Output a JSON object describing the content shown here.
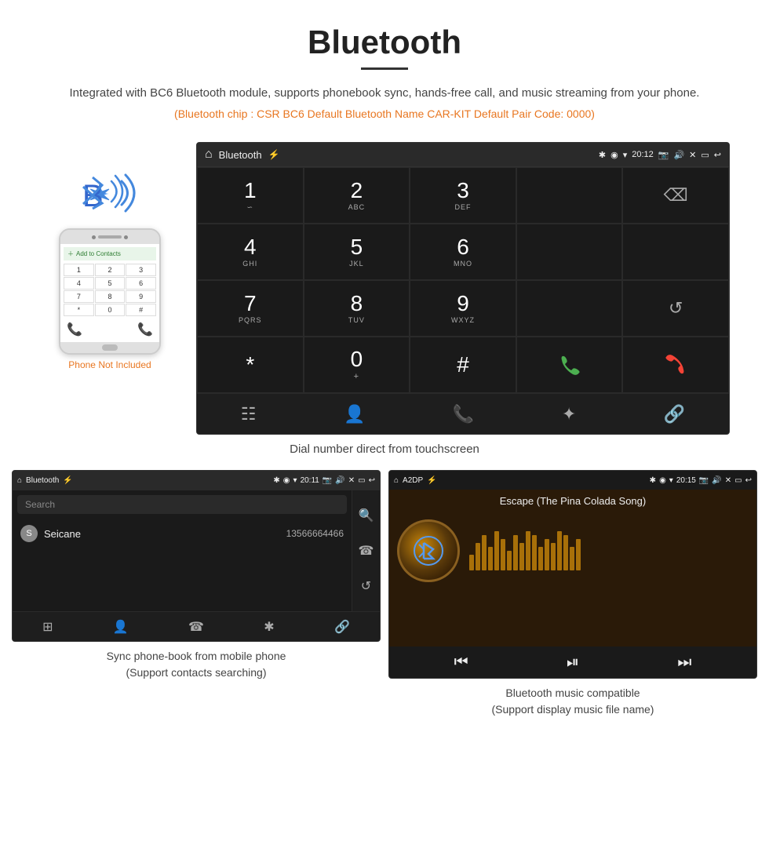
{
  "header": {
    "title": "Bluetooth",
    "description": "Integrated with BC6 Bluetooth module, supports phonebook sync, hands-free call, and music streaming from your phone.",
    "specs": "(Bluetooth chip : CSR BC6    Default Bluetooth Name CAR-KIT    Default Pair Code: 0000)"
  },
  "phone_note": "Phone Not Included",
  "dial_screen": {
    "status_bar": {
      "home": "⌂",
      "label": "Bluetooth",
      "usb": "⚡",
      "time": "20:12",
      "icons": "✱ ◉ ▾"
    },
    "keys": [
      {
        "number": "1",
        "letters": "∽"
      },
      {
        "number": "2",
        "letters": "ABC"
      },
      {
        "number": "3",
        "letters": "DEF"
      },
      {
        "number": "",
        "letters": ""
      },
      {
        "number": "⌫",
        "letters": ""
      },
      {
        "number": "4",
        "letters": "GHI"
      },
      {
        "number": "5",
        "letters": "JKL"
      },
      {
        "number": "6",
        "letters": "MNO"
      },
      {
        "number": "",
        "letters": ""
      },
      {
        "number": "",
        "letters": ""
      },
      {
        "number": "7",
        "letters": "PQRS"
      },
      {
        "number": "8",
        "letters": "TUV"
      },
      {
        "number": "9",
        "letters": "WXYZ"
      },
      {
        "number": "",
        "letters": ""
      },
      {
        "number": "↺",
        "letters": ""
      },
      {
        "number": "*",
        "letters": ""
      },
      {
        "number": "0",
        "letters": "+"
      },
      {
        "number": "#",
        "letters": ""
      },
      {
        "number": "📞",
        "letters": "green"
      },
      {
        "number": "📵",
        "letters": "red"
      }
    ],
    "nav_icons": [
      "⊞",
      "👤",
      "☎",
      "✱",
      "🔗"
    ]
  },
  "dial_caption": "Dial number direct from touchscreen",
  "phonebook_screen": {
    "status_label": "Bluetooth",
    "time": "20:11",
    "search_placeholder": "Search",
    "contacts": [
      {
        "initial": "S",
        "name": "Seicane",
        "number": "13566664466"
      }
    ],
    "action_icons": [
      "🔍",
      "☎",
      "↺"
    ]
  },
  "phonebook_caption": "Sync phone-book from mobile phone\n(Support contacts searching)",
  "music_screen": {
    "status_label": "A2DP",
    "time": "20:15",
    "song_title": "Escape (The Pina Colada Song)",
    "eq_bars": [
      20,
      35,
      45,
      30,
      50,
      40,
      25,
      45,
      35,
      50,
      45,
      30,
      40,
      35,
      50,
      45,
      30,
      40
    ],
    "controls": [
      "⏮",
      "⏭",
      "⏭"
    ]
  },
  "music_caption": "Bluetooth music compatible\n(Support display music file name)"
}
